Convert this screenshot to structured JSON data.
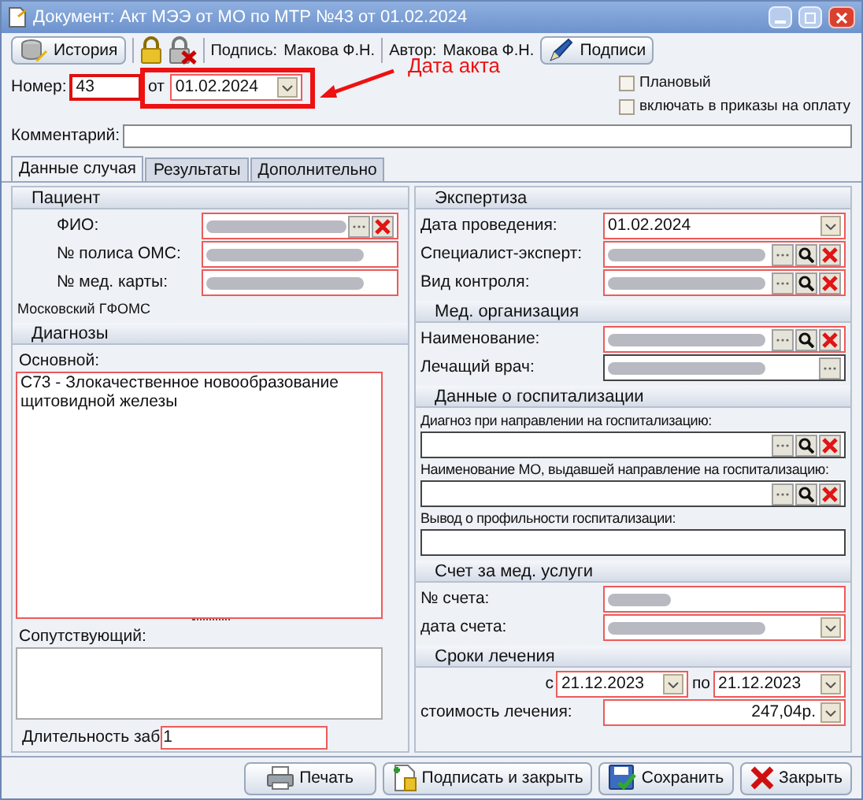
{
  "window": {
    "title": "Документ: Акт МЭЭ от МО по МТР №43 от 01.02.2024"
  },
  "toolbar": {
    "history_button": "История",
    "sign_label": "Подпись:",
    "sign_value": "Макова Ф.Н.",
    "author_label": "Автор:",
    "author_value": "Макова Ф.Н.",
    "signatures_button": "Подписи"
  },
  "header": {
    "number_label": "Номер:",
    "number_value": "43",
    "date_label": "от",
    "date_value": "01.02.2024",
    "annotation": "Дата акта",
    "checkboxes": [
      {
        "label": "Плановый",
        "checked": false
      },
      {
        "label": "включать в приказы на оплату",
        "checked": false
      }
    ],
    "comment_label": "Комментарий:"
  },
  "tabs": [
    {
      "label": "Данные случая",
      "selected": true
    },
    {
      "label": "Результаты",
      "selected": false
    },
    {
      "label": "Дополнительно",
      "selected": false
    }
  ],
  "patient": {
    "title": "Пациент",
    "fields": [
      {
        "label": "ФИО:",
        "kind": "lookup",
        "required": true,
        "redacted": true
      },
      {
        "label": "№ полиса ОМС:",
        "kind": "text",
        "required": true,
        "redacted": true
      },
      {
        "label": "№ мед. карты:",
        "kind": "text",
        "required": true,
        "redacted": true
      }
    ],
    "fund": "Московский ГФОМС"
  },
  "diagnoses": {
    "title": "Диагнозы",
    "main_label": "Основной:",
    "main_value": "C73 - Злокачественное новообразование щитовидной железы",
    "secondary_label": "Сопутствующий:",
    "duration_label": "Длительность заб",
    "duration_value": "1"
  },
  "sections": [
    {
      "title": "Экспертиза",
      "kind": "inline",
      "fields": [
        {
          "label": "Дата проведения:",
          "kind": "date",
          "required": true,
          "value": "01.02.2024"
        },
        {
          "label": "Специалист-эксперт:",
          "kind": "lookup3",
          "required": true,
          "redacted": true
        },
        {
          "label": "Вид контроля:",
          "kind": "lookup3",
          "required": true,
          "redacted": true
        }
      ]
    },
    {
      "title": "Мед. организация",
      "kind": "inline",
      "fields": [
        {
          "label": "Наименование:",
          "kind": "lookup3",
          "required": true,
          "redacted": true
        },
        {
          "label": "Лечащий врач:",
          "kind": "lookup",
          "required": false,
          "redacted": true
        }
      ]
    },
    {
      "title": "Данные о госпитализации",
      "kind": "stacked",
      "fields": [
        {
          "label": "Диагноз при направлении на госпитализацию:",
          "kind": "lookup3",
          "required": false
        },
        {
          "label": "Наименование МО, выдавшей направление на госпитализацию:",
          "kind": "lookup3",
          "required": false
        },
        {
          "label": "Вывод о профильности госпитализации:",
          "kind": "text",
          "required": false
        }
      ]
    },
    {
      "title": "Счет за мед. услуги",
      "kind": "inline",
      "fields": [
        {
          "label": "№ счета:",
          "kind": "text",
          "required": true,
          "redacted": true
        },
        {
          "label": "дата счета:",
          "kind": "date",
          "required": true,
          "redacted": true
        }
      ]
    },
    {
      "title": "Сроки лечения",
      "kind": "inline",
      "fields": [
        {
          "kind": "period",
          "from_label": "с",
          "from_value": "21.12.2023",
          "to_label": "по",
          "to_value": "21.12.2023",
          "required": true
        },
        {
          "label": "стоимость лечения:",
          "kind": "money",
          "required": true,
          "value": "247,04р."
        }
      ]
    }
  ],
  "buttons": [
    {
      "label": "Печать",
      "kind": "print"
    },
    {
      "label": "Подписать и закрыть",
      "kind": "sign"
    },
    {
      "label": "Сохранить",
      "kind": "save"
    },
    {
      "label": "Закрыть",
      "kind": "close"
    }
  ]
}
